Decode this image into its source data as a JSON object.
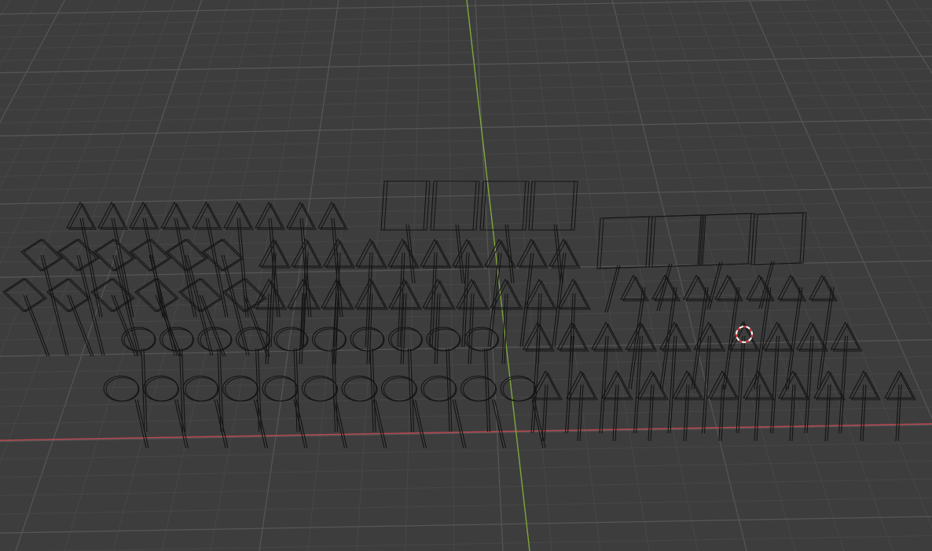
{
  "viewport": {
    "view": "perspective",
    "shading": "wireframe",
    "colors": {
      "background": "#3d3d3d",
      "grid_minor": "#474747",
      "grid_major": "#555555",
      "axis_x": "#b8474f",
      "axis_y": "#7fa83a",
      "wire": "#141414",
      "cursor_red": "#d8383c",
      "cursor_white": "#f2f2f2"
    }
  },
  "objects": {
    "sign_types": [
      "triangle-sign",
      "diamond-sign",
      "round-sign",
      "rectangle-sign",
      "pole"
    ],
    "groups": [
      {
        "name": "triangle-signs-left-row",
        "type": "triangle-sign",
        "count": 9
      },
      {
        "name": "diamond-signs-row-1",
        "type": "diamond-sign",
        "count": 6
      },
      {
        "name": "diamond-signs-row-2",
        "type": "diamond-sign",
        "count": 6
      },
      {
        "name": "rectangle-signs-center",
        "type": "rectangle-sign",
        "count": 4
      },
      {
        "name": "rectangle-signs-right",
        "type": "rectangle-sign",
        "count": 4
      },
      {
        "name": "triangle-signs-center-row-1",
        "type": "triangle-sign",
        "count": 10
      },
      {
        "name": "triangle-signs-center-row-2",
        "type": "triangle-sign",
        "count": 10
      },
      {
        "name": "round-signs-row-1",
        "type": "round-sign",
        "count": 10
      },
      {
        "name": "round-signs-row-2",
        "type": "round-sign",
        "count": 11
      },
      {
        "name": "triangle-signs-right-row-1",
        "type": "triangle-sign",
        "count": 7
      },
      {
        "name": "triangle-signs-right-row-2",
        "type": "triangle-sign",
        "count": 10
      },
      {
        "name": "triangle-signs-right-row-3",
        "type": "triangle-sign",
        "count": 11
      }
    ]
  },
  "cursor": {
    "icon": "3d-cursor-icon"
  }
}
